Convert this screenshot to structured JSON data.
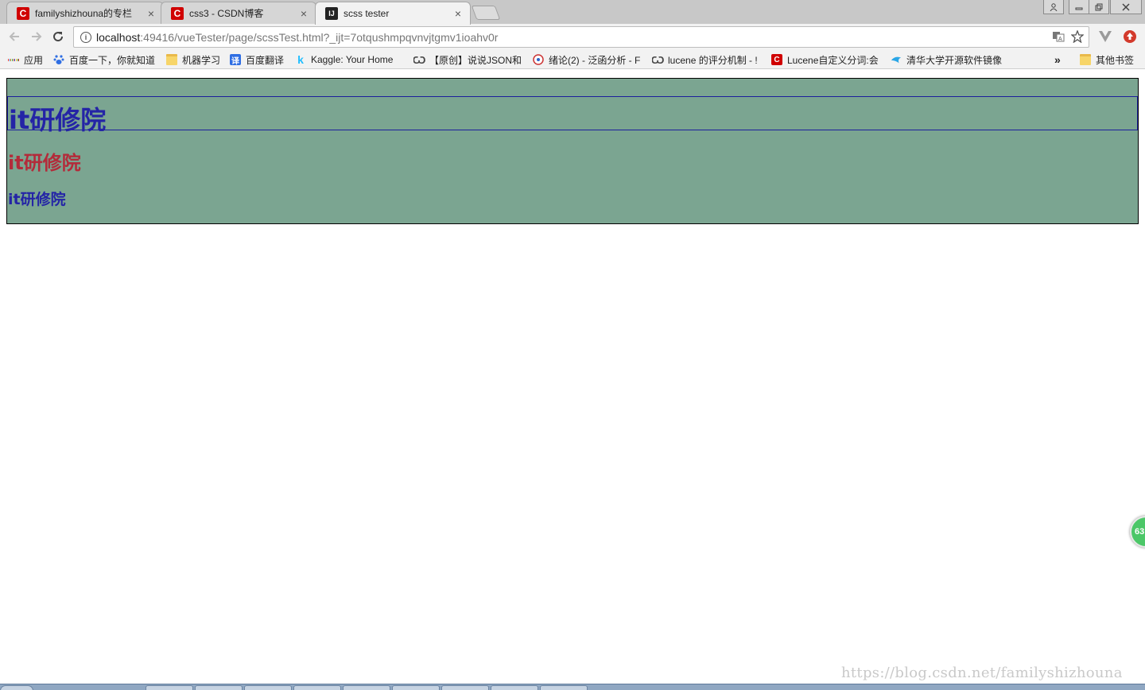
{
  "tabs": [
    {
      "title": "familyshizhouna的专栏",
      "favicon": "csdn-icon",
      "active": false
    },
    {
      "title": "css3 - CSDN博客",
      "favicon": "csdn-icon",
      "active": false
    },
    {
      "title": "scss tester",
      "favicon": "intellij-icon",
      "active": true
    }
  ],
  "tab_close_glyph": "×",
  "toolbar": {
    "url_host": "localhost",
    "url_rest": ":49416/vueTester/page/scssTest.html?_ijt=7otqushmpqvnvjtgmv1ioahv0r"
  },
  "bookmarks": [
    {
      "label": "应用",
      "icon": "apps-grid-icon"
    },
    {
      "label": "百度一下，你就知道",
      "icon": "baidu-paw-icon"
    },
    {
      "label": "机器学习",
      "icon": "folder-icon"
    },
    {
      "label": "百度翻译",
      "icon": "baidu-translate-icon"
    },
    {
      "label": "Kaggle: Your Home",
      "icon": "kaggle-icon"
    },
    {
      "label": "【原创】说说JSON和",
      "icon": "omega-icon"
    },
    {
      "label": "绪论(2) - 泛函分析 - F",
      "icon": "compass-icon"
    },
    {
      "label": "lucene 的评分机制 - !",
      "icon": "omega-icon"
    },
    {
      "label": "Lucene自定义分词:会",
      "icon": "csdn-icon"
    },
    {
      "label": "清华大学开源软件镜像",
      "icon": "tuna-icon"
    }
  ],
  "bookmarks_overflow": "»",
  "other_bookmarks": "其他书签",
  "page": {
    "h1": "it研修院",
    "h2": "it研修院",
    "h3": "it研修院"
  },
  "float_badge": "63",
  "watermark": "https://blog.csdn.net/familyshizhouna",
  "colors": {
    "container_bg": "#7ba591",
    "h1_color": "#2424a6",
    "h2_color": "#b32b3a",
    "h3_color": "#2424a6",
    "csdn_red": "#d00000"
  }
}
